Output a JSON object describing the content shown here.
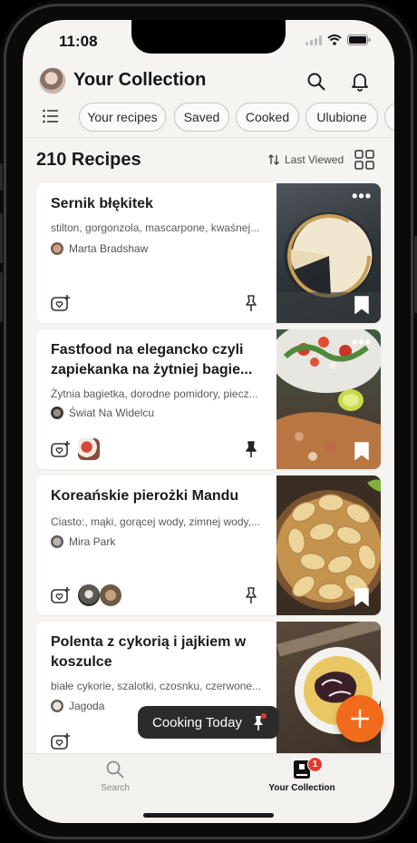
{
  "status": {
    "time": "11:08"
  },
  "header": {
    "title": "Your Collection"
  },
  "filters": {
    "chips": [
      "Your recipes",
      "Saved",
      "Cooked",
      "Ulubione"
    ]
  },
  "list": {
    "count_label": "210 Recipes",
    "sort_label": "Last Viewed"
  },
  "recipes": [
    {
      "title": "Sernik błękitek",
      "ingredients": "stilton, gorgonzola, mascarpone, kwaśnej...",
      "author": "Marta Bradshaw"
    },
    {
      "title": "Fastfood na elegancko czyli zapiekanka na żytniej bagie...",
      "ingredients": "Żytnia bagietka, dorodne pomidory, piecz...",
      "author": "Świat Na Widelcu"
    },
    {
      "title": "Koreańskie pierożki Mandu",
      "ingredients": "Ciasto:, mąki, gorącej wody, zimnej wody,...",
      "author": "Mira Park"
    },
    {
      "title": "Polenta z cykorią i jajkiem w koszulce",
      "ingredients": "białe cykorie, szalotki, czosnku, czerwone...",
      "author": "Jagoda"
    }
  ],
  "toast": {
    "label": "Cooking Today"
  },
  "tabbar": {
    "search_label": "Search",
    "collection_label": "Your Collection",
    "collection_badge": "1"
  },
  "colors": {
    "accent": "#f26b1d",
    "badge": "#e23b2e",
    "background": "#f6f4f0"
  }
}
